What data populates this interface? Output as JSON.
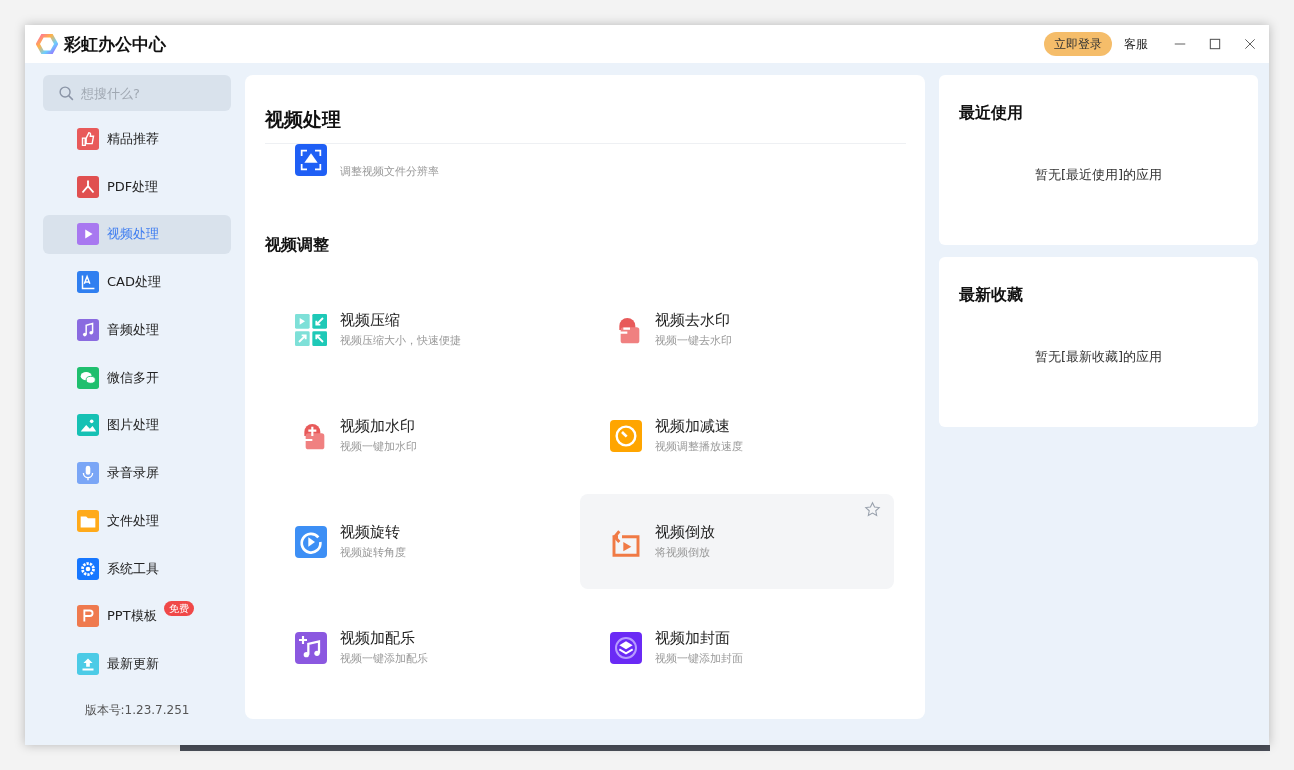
{
  "window": {
    "title": "彩虹办公中心",
    "login": "立即登录",
    "service": "客服"
  },
  "sidebar": {
    "search": {
      "placeholder": "想搜什么?"
    },
    "items": [
      {
        "label": "精品推荐",
        "kind": "thumb",
        "selected": false
      },
      {
        "label": "PDF处理",
        "kind": "pdf",
        "selected": false
      },
      {
        "label": "视频处理",
        "kind": "video",
        "selected": true
      },
      {
        "label": "CAD处理",
        "kind": "cad",
        "selected": false
      },
      {
        "label": "音频处理",
        "kind": "audio",
        "selected": false
      },
      {
        "label": "微信多开",
        "kind": "chat",
        "selected": false
      },
      {
        "label": "图片处理",
        "kind": "image",
        "selected": false
      },
      {
        "label": "录音录屏",
        "kind": "mic",
        "selected": false
      },
      {
        "label": "文件处理",
        "kind": "folder",
        "selected": false
      },
      {
        "label": "系统工具",
        "kind": "gear",
        "selected": false
      },
      {
        "label": "PPT模板",
        "kind": "ppt",
        "selected": false,
        "badge": "免费"
      },
      {
        "label": "最新更新",
        "kind": "upload",
        "selected": false
      }
    ],
    "version": "版本号:1.23.7.251"
  },
  "main": {
    "title": "视频处理",
    "clipped_tool": {
      "kind": "resolution",
      "description": "调整视频文件分辨率"
    },
    "section": "视频调整",
    "tools": [
      {
        "title": "视频压缩",
        "description": "视频压缩大小，快速便捷",
        "kind": "compress",
        "hovered": false
      },
      {
        "title": "视频去水印",
        "description": "视频一键去水印",
        "kind": "unmark",
        "hovered": false
      },
      {
        "title": "视频加水印",
        "description": "视频一键加水印",
        "kind": "addmark",
        "hovered": false
      },
      {
        "title": "视频加减速",
        "description": "视频调整播放速度",
        "kind": "speed",
        "hovered": false
      },
      {
        "title": "视频旋转",
        "description": "视频旋转角度",
        "kind": "rotate",
        "hovered": false
      },
      {
        "title": "视频倒放",
        "description": "将视频倒放",
        "kind": "reverse",
        "hovered": true
      },
      {
        "title": "视频加配乐",
        "description": "视频一键添加配乐",
        "kind": "music",
        "hovered": false
      },
      {
        "title": "视频加封面",
        "description": "视频一键添加封面",
        "kind": "cover",
        "hovered": false
      }
    ]
  },
  "panels": [
    {
      "title": "最近使用",
      "empty": "暂无[最近使用]的应用"
    },
    {
      "title": "最新收藏",
      "empty": "暂无[最新收藏]的应用"
    }
  ]
}
